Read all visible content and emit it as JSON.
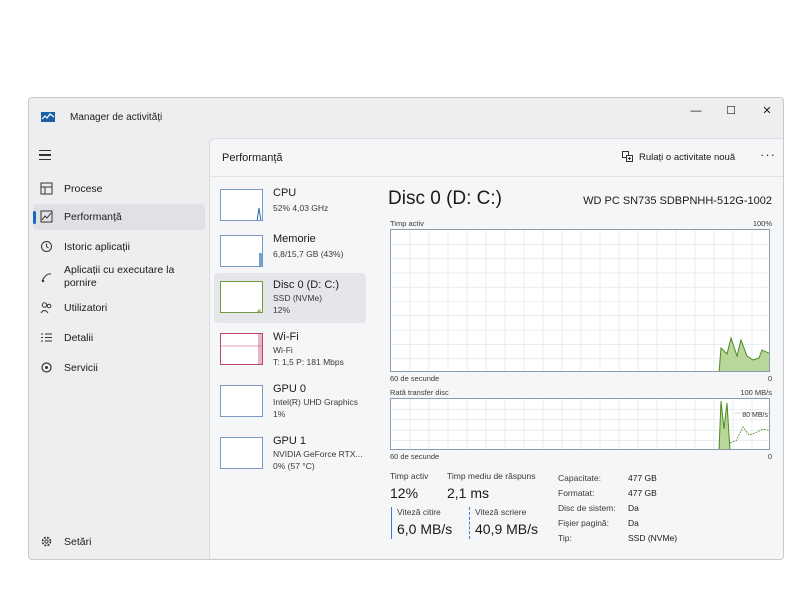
{
  "app": {
    "title": "Manager de activități"
  },
  "window_controls": {
    "minimize": "—",
    "maximize": "☐",
    "close": "✕"
  },
  "sidebar": {
    "items": [
      {
        "label": "Procese",
        "icon": "processes-icon"
      },
      {
        "label": "Performanță",
        "icon": "performance-icon",
        "active": true
      },
      {
        "label": "Istoric aplicații",
        "icon": "history-icon"
      },
      {
        "label": "Aplicații cu executare la pornire",
        "icon": "startup-icon"
      },
      {
        "label": "Utilizatori",
        "icon": "users-icon"
      },
      {
        "label": "Detalii",
        "icon": "details-icon"
      },
      {
        "label": "Servicii",
        "icon": "services-icon"
      }
    ],
    "settings_label": "Setări"
  },
  "header": {
    "title": "Performanță",
    "run_task_label": "Rulați o activitate nouă",
    "more_label": "···"
  },
  "devices": [
    {
      "name": "CPU",
      "line1": "52%  4,03 GHz",
      "line2": "",
      "line3": ""
    },
    {
      "name": "Memorie",
      "line1": "6,8/15,7 GB (43%)",
      "line2": "",
      "line3": ""
    },
    {
      "name": "Disc 0 (D: C:)",
      "line1": "SSD (NVMe)",
      "line2": "12%",
      "line3": "",
      "active": true
    },
    {
      "name": "Wi-Fi",
      "line1": "Wi-Fi",
      "line2": "T: 1,5  P: 181 Mbps",
      "line3": ""
    },
    {
      "name": "GPU 0",
      "line1": "Intel(R) UHD Graphics",
      "line2": "1%",
      "line3": ""
    },
    {
      "name": "GPU 1",
      "line1": "NVIDIA GeForce RTX...",
      "line2": "0%  (57 °C)",
      "line3": ""
    }
  ],
  "detail": {
    "title": "Disc 0 (D: C:)",
    "model": "WD PC SN735 SDBPNHH-512G-1002",
    "graph1": {
      "label": "Timp activ",
      "max_label": "100%",
      "time_label": "60 de secunde",
      "min_label": "0"
    },
    "graph2": {
      "label": "Rată transfer disc",
      "max_label": "100 MB/s",
      "mid_label": "80 MB/s",
      "time_label": "60 de secunde",
      "min_label": "0"
    },
    "stats": {
      "active_time_label": "Timp activ",
      "active_time_value": "12%",
      "response_label": "Timp mediu de răspuns",
      "response_value": "2,1 ms",
      "read_label": "Viteză citire",
      "read_value": "6,0 MB/s",
      "write_label": "Viteză scriere",
      "write_value": "40,9 MB/s"
    },
    "properties": [
      {
        "key": "Capacitate:",
        "value": "477 GB"
      },
      {
        "key": "Formatat:",
        "value": "477 GB"
      },
      {
        "key": "Disc de sistem:",
        "value": "Da"
      },
      {
        "key": "Fișier pagină:",
        "value": "Da"
      },
      {
        "key": "Tip:",
        "value": "SSD (NVMe)"
      }
    ]
  },
  "colors": {
    "accent": "#1867c0",
    "disk_graph": "#4c8a1f",
    "disk_fill": "#b9d79a",
    "wifi": "#c2466a",
    "graph_border": "#8c9cb0"
  }
}
